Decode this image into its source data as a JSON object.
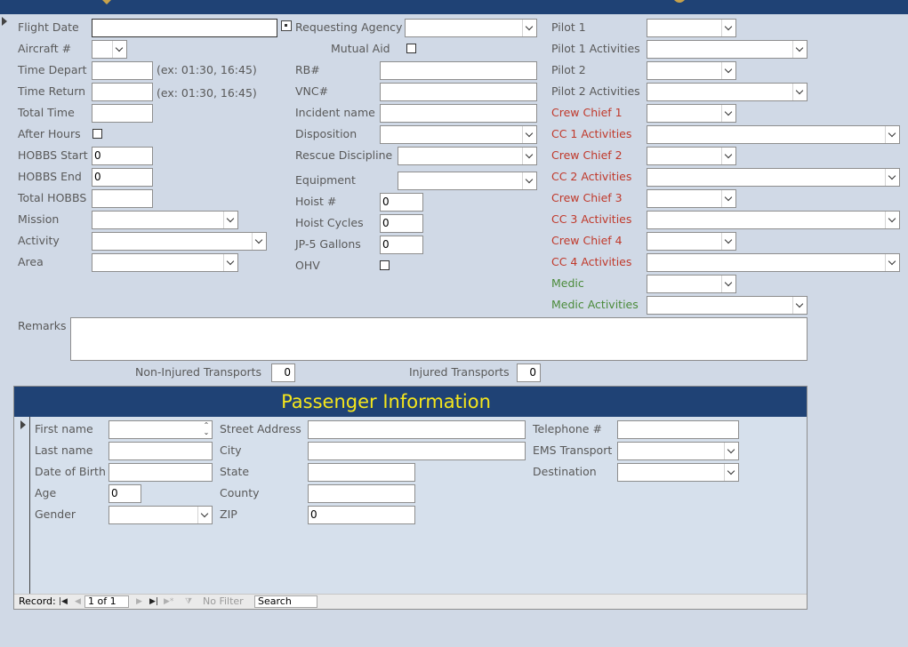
{
  "form": {
    "flight_date": {
      "label": "Flight Date",
      "value": ""
    },
    "aircraft": {
      "label": "Aircraft #",
      "value": ""
    },
    "time_depart": {
      "label": "Time Depart",
      "value": "",
      "hint": "(ex: 01:30, 16:45)"
    },
    "time_return": {
      "label": "Time Return",
      "value": "",
      "hint": "(ex: 01:30, 16:45)"
    },
    "total_time": {
      "label": "Total Time",
      "value": ""
    },
    "after_hours": {
      "label": "After Hours",
      "checked": false
    },
    "hobbs_start": {
      "label": "HOBBS Start",
      "value": "0"
    },
    "hobbs_end": {
      "label": "HOBBS End",
      "value": "0"
    },
    "total_hobbs": {
      "label": "Total HOBBS",
      "value": ""
    },
    "mission": {
      "label": "Mission",
      "value": ""
    },
    "activity": {
      "label": "Activity",
      "value": ""
    },
    "area": {
      "label": "Area",
      "value": ""
    },
    "requesting_agency": {
      "label": "Requesting Agency",
      "value": ""
    },
    "mutual_aid": {
      "label": "Mutual Aid",
      "checked": false
    },
    "rb": {
      "label": "RB#",
      "value": ""
    },
    "vnc": {
      "label": "VNC#",
      "value": ""
    },
    "incident_name": {
      "label": "Incident name",
      "value": ""
    },
    "disposition": {
      "label": "Disposition",
      "value": ""
    },
    "rescue_discipline": {
      "label": "Rescue Discipline",
      "value": ""
    },
    "equipment": {
      "label": "Equipment",
      "value": ""
    },
    "hoist": {
      "label": "Hoist #",
      "value": "0"
    },
    "hoist_cycles": {
      "label": "Hoist Cycles",
      "value": "0"
    },
    "jp5": {
      "label": "JP-5 Gallons",
      "value": "0"
    },
    "ohv": {
      "label": "OHV",
      "checked": false
    },
    "pilot1": {
      "label": "Pilot 1",
      "value": ""
    },
    "pilot1_activities": {
      "label": "Pilot 1 Activities",
      "value": ""
    },
    "pilot2": {
      "label": "Pilot 2",
      "value": ""
    },
    "pilot2_activities": {
      "label": "Pilot 2 Activities",
      "value": ""
    },
    "crew_chief1": {
      "label": "Crew Chief 1",
      "value": ""
    },
    "cc1_activities": {
      "label": "CC 1 Activities",
      "value": ""
    },
    "crew_chief2": {
      "label": "Crew Chief 2",
      "value": ""
    },
    "cc2_activities": {
      "label": "CC 2 Activities",
      "value": ""
    },
    "crew_chief3": {
      "label": "Crew Chief 3",
      "value": ""
    },
    "cc3_activities": {
      "label": "CC 3 Activities",
      "value": ""
    },
    "crew_chief4": {
      "label": "Crew Chief 4",
      "value": ""
    },
    "cc4_activities": {
      "label": "CC 4 Activities",
      "value": ""
    },
    "medic": {
      "label": "Medic",
      "value": ""
    },
    "medic_activities": {
      "label": "Medic Activities",
      "value": ""
    },
    "remarks": {
      "label": "Remarks",
      "value": ""
    },
    "non_injured": {
      "label": "Non-Injured Transports",
      "value": "0"
    },
    "injured": {
      "label": "Injured Transports",
      "value": "0"
    }
  },
  "passenger": {
    "title": "Passenger Information",
    "first_name": {
      "label": "First name",
      "value": ""
    },
    "last_name": {
      "label": "Last name",
      "value": ""
    },
    "dob": {
      "label": "Date of Birth",
      "value": ""
    },
    "age": {
      "label": "Age",
      "value": "0"
    },
    "gender": {
      "label": "Gender",
      "value": ""
    },
    "street": {
      "label": "Street Address",
      "value": ""
    },
    "city": {
      "label": "City",
      "value": ""
    },
    "state": {
      "label": "State",
      "value": ""
    },
    "county": {
      "label": "County",
      "value": ""
    },
    "zip": {
      "label": "ZIP",
      "value": "0"
    },
    "telephone": {
      "label": "Telephone #",
      "value": ""
    },
    "ems_transport": {
      "label": "EMS Transport",
      "value": ""
    },
    "destination": {
      "label": "Destination",
      "value": ""
    }
  },
  "navigation": {
    "record_label": "Record:",
    "position": "1 of 1",
    "filter_label": "No Filter",
    "search_placeholder": "Search"
  },
  "colors": {
    "header": "#1f4275",
    "title": "#f5e61c",
    "background": "#d0d9e6",
    "crew": "#c0392b",
    "medic": "#4b8b3b"
  }
}
